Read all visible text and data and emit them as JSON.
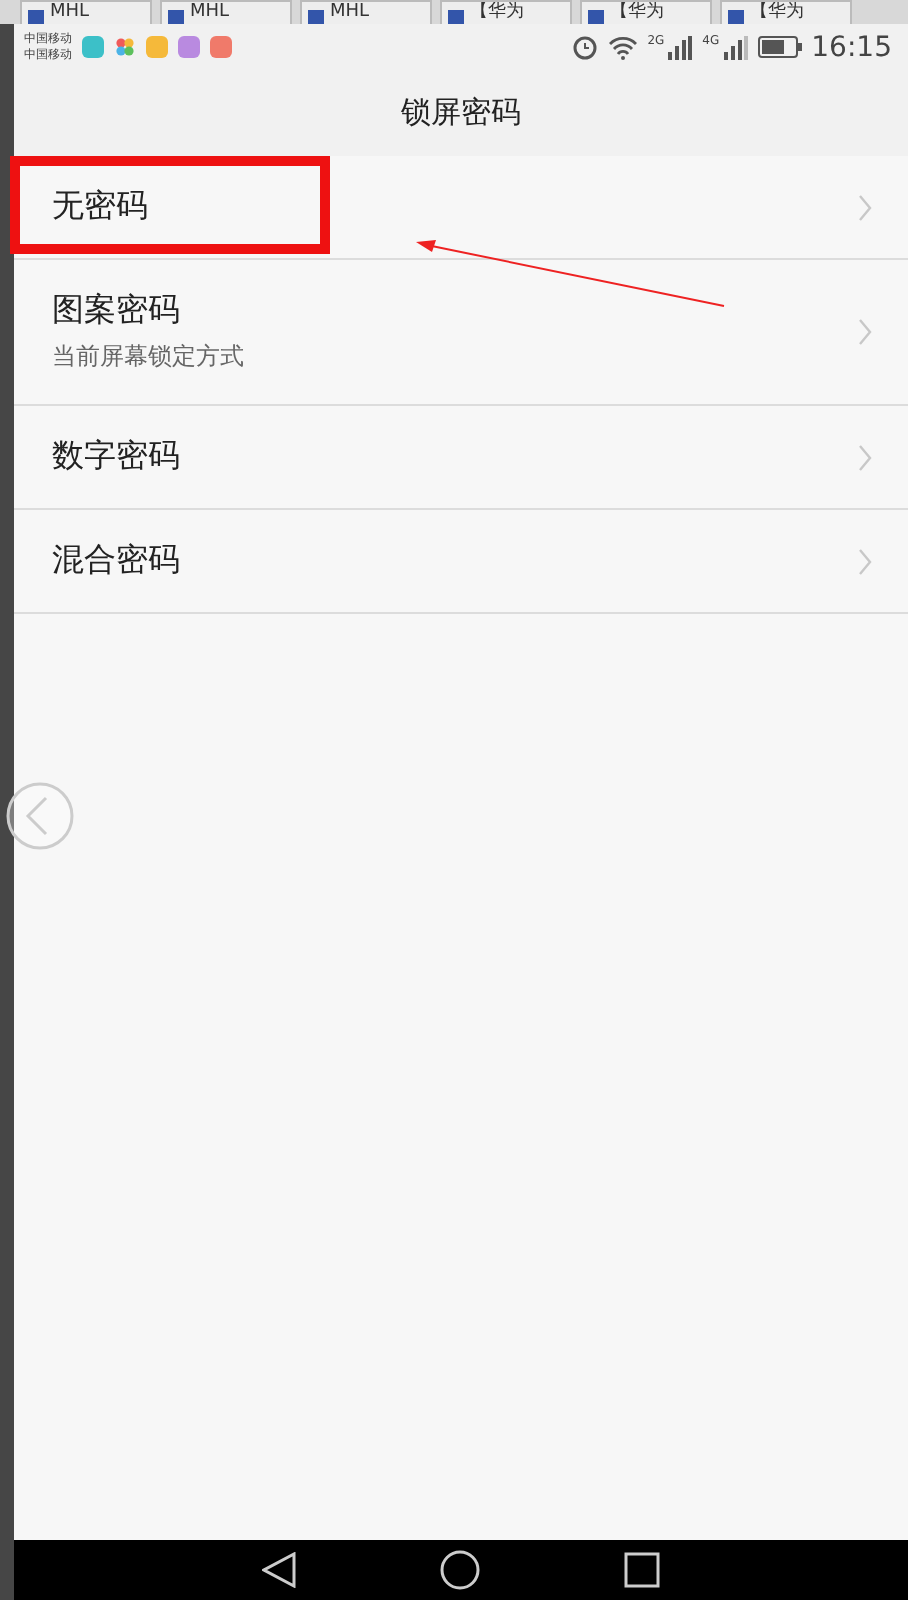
{
  "browser_tabs": [
    {
      "label": "MHL"
    },
    {
      "label": "MHL"
    },
    {
      "label": "MHL"
    },
    {
      "label": "【华为"
    },
    {
      "label": "【华为"
    },
    {
      "label": "【华为"
    }
  ],
  "status_bar": {
    "carriers": [
      "中国移动",
      "中国移动"
    ],
    "app_icons": [
      {
        "kind": "tile",
        "color": "#3cc0c8"
      },
      {
        "kind": "petals"
      },
      {
        "kind": "tile",
        "color": "#f5b93a"
      },
      {
        "kind": "tile",
        "color": "#b98ae0"
      },
      {
        "kind": "tile",
        "color": "#f07a6a"
      }
    ],
    "network_labels": [
      "2G",
      "4G"
    ],
    "time": "16:15"
  },
  "header": {
    "title": "锁屏密码"
  },
  "options": [
    {
      "label": "无密码",
      "highlighted": true
    },
    {
      "label": "图案密码",
      "subtitle": "当前屏幕锁定方式",
      "highlighted": false
    },
    {
      "label": "数字密码",
      "highlighted": false
    },
    {
      "label": "混合密码",
      "highlighted": false
    }
  ]
}
